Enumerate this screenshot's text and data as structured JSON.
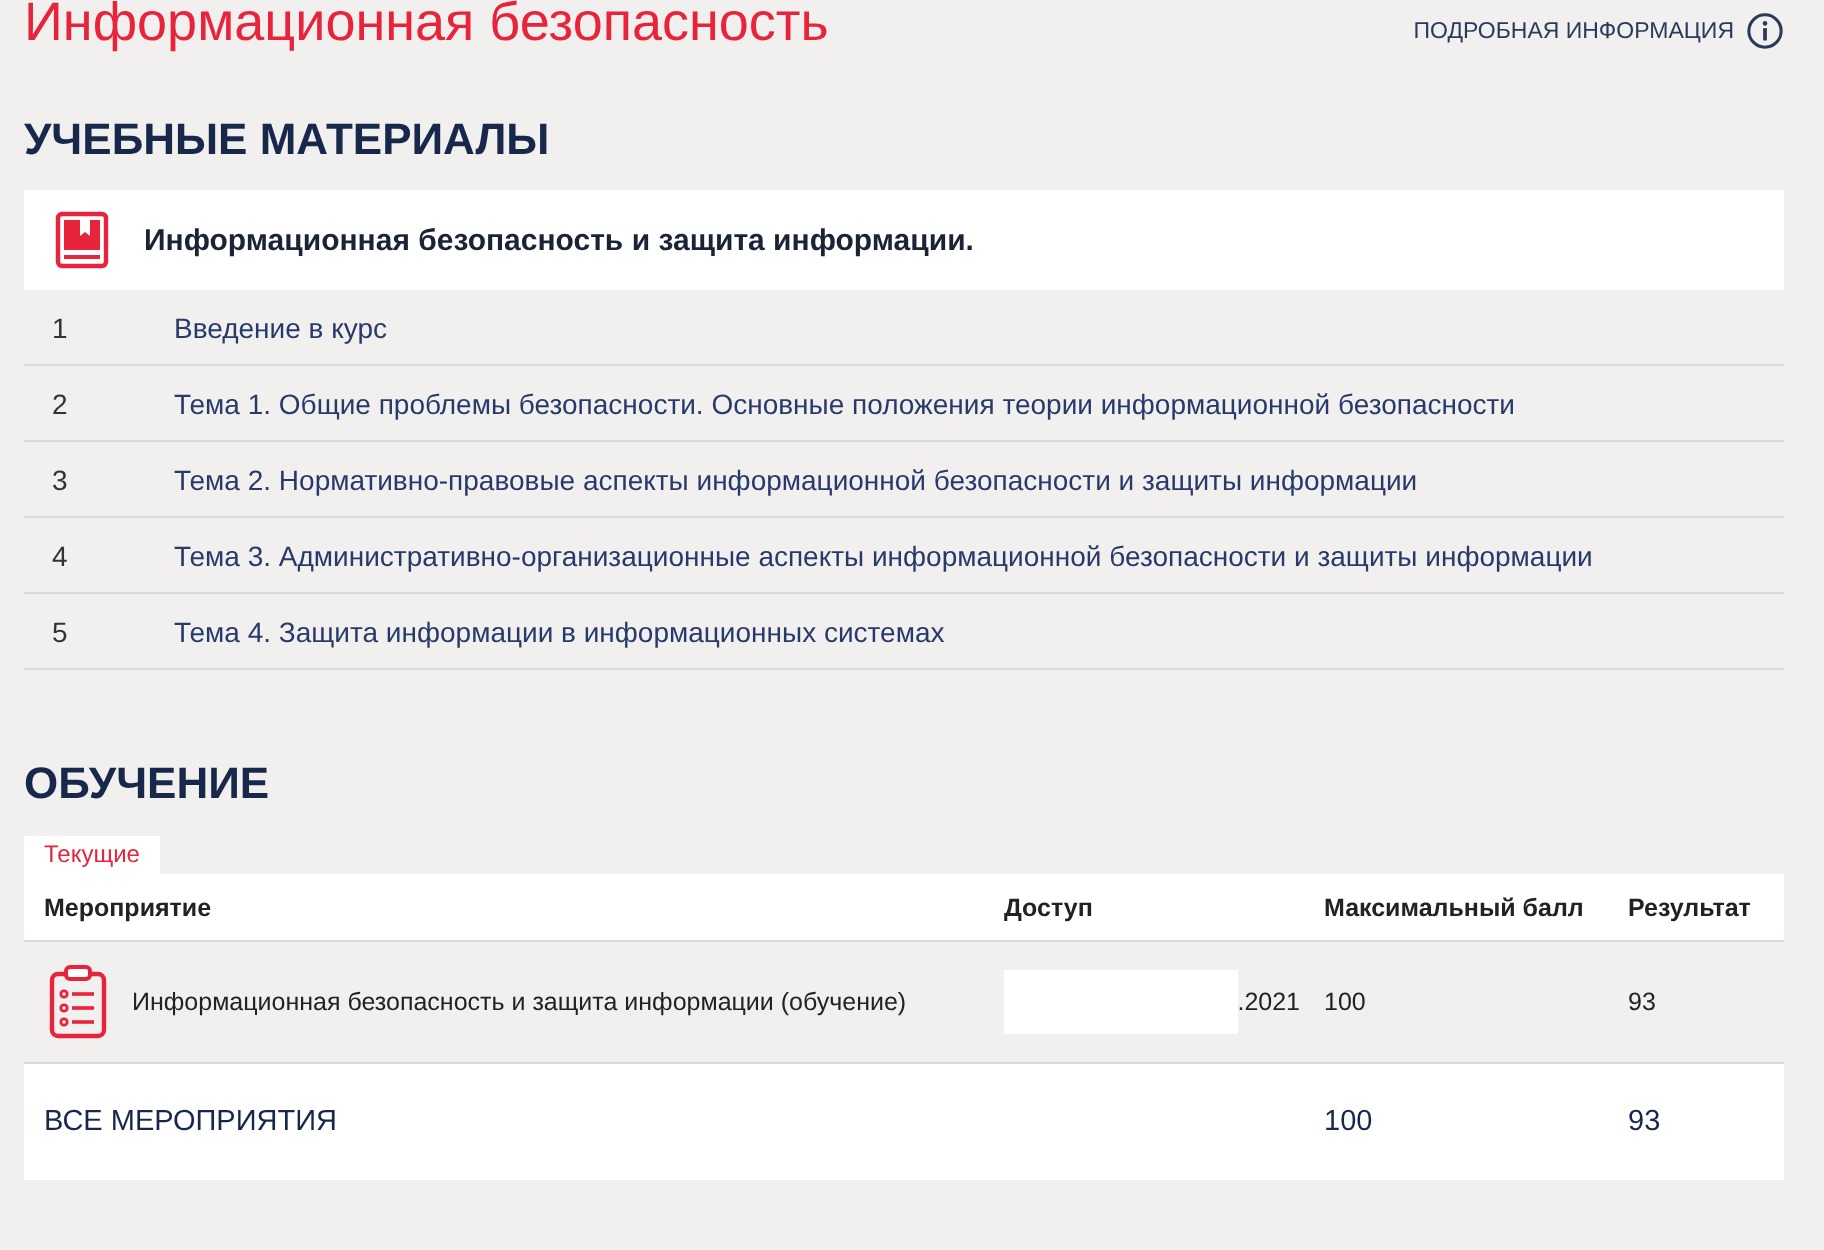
{
  "page": {
    "title": "Информационная безопасность",
    "info_link": "ПОДРОБНАЯ ИНФОРМАЦИЯ"
  },
  "materials": {
    "heading": "УЧЕБНЫЕ МАТЕРИАЛЫ",
    "course_title": "Информационная безопасность и защита информации.",
    "items": [
      {
        "number": "1",
        "title": "Введение в курс"
      },
      {
        "number": "2",
        "title": "Тема 1. Общие проблемы безопасности. Основные положения теории информационной безопасности"
      },
      {
        "number": "3",
        "title": "Тема 2. Нормативно-правовые аспекты информационной безопасности и защиты информации"
      },
      {
        "number": "4",
        "title": "Тема 3. Административно-организационные аспекты информационной безопасности и защиты информации"
      },
      {
        "number": "5",
        "title": "Тема 4. Защита информации в информационных системах"
      }
    ]
  },
  "training": {
    "heading": "ОБУЧЕНИЕ",
    "tabs": [
      {
        "label": "Текущие",
        "selected": true
      }
    ],
    "table": {
      "columns": [
        "Мероприятие",
        "Доступ",
        "Максимальный балл",
        "Результат"
      ],
      "rows": [
        {
          "event": "Информационная безопасность и защита информации (обучение)",
          "access": ".2021",
          "max_score": "100",
          "result": "93"
        }
      ],
      "total": {
        "label": "ВСЕ МЕРОПРИЯТИЯ",
        "max_score": "100",
        "result": "93"
      }
    }
  }
}
